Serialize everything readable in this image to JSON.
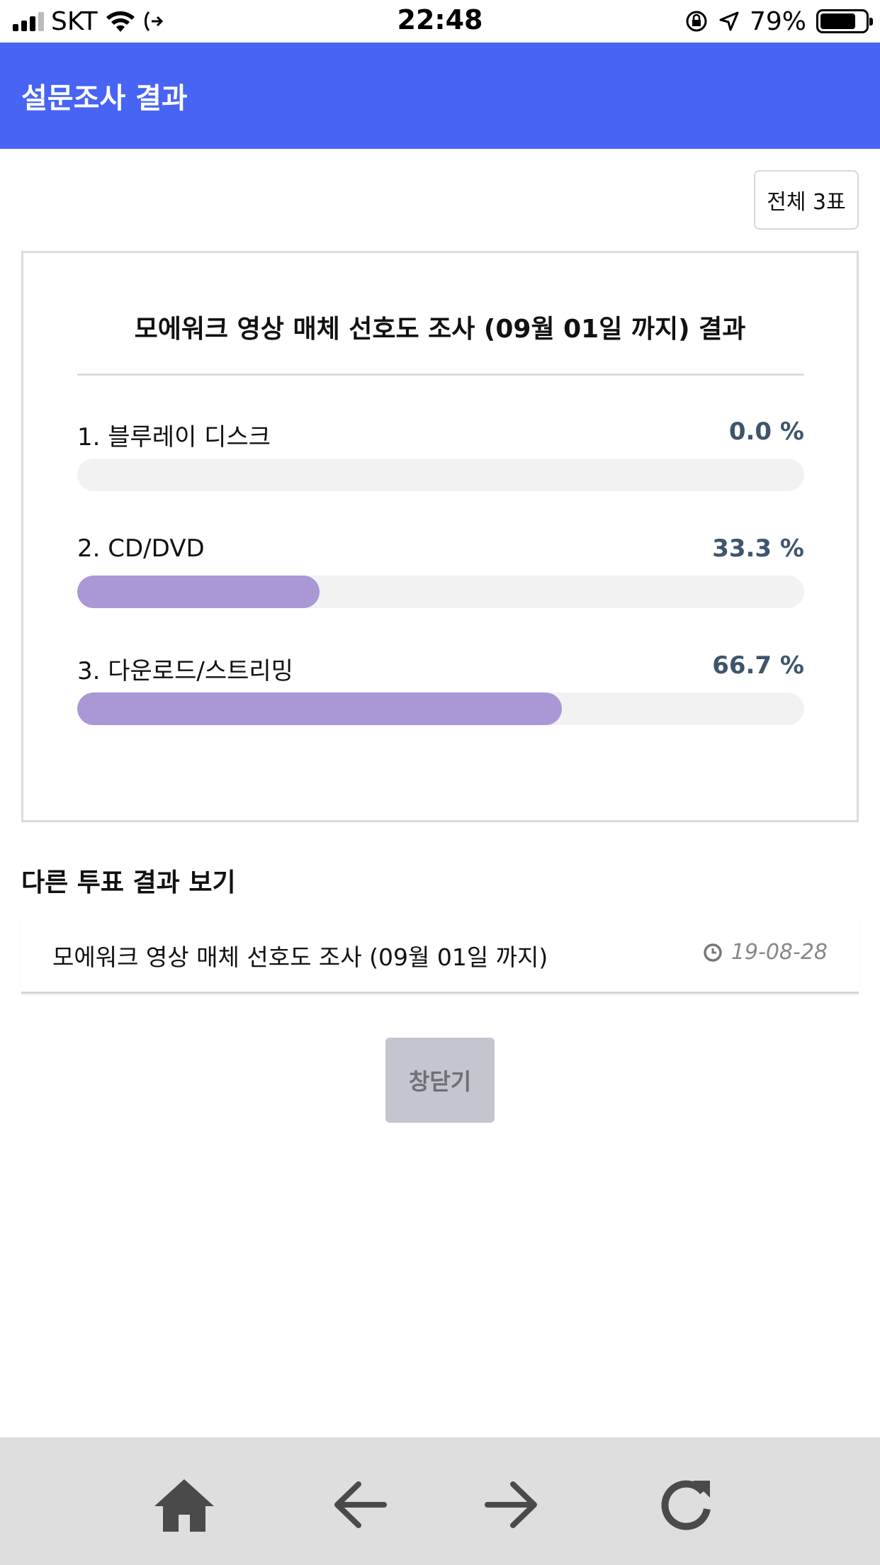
{
  "status_bar": {
    "carrier": "SKT",
    "time": "22:48",
    "battery": "79%",
    "battery_level": 0.79,
    "icons": [
      "signal-icon",
      "wifi-icon",
      "call-forward-icon",
      "rotation-lock-icon",
      "location-icon",
      "battery-icon"
    ]
  },
  "app_bar": {
    "title": "설문조사 결과"
  },
  "total_votes": "전체 3표",
  "result": {
    "title": "모에워크 영상 매체 선호도 조사 (09월 01일 까지) 결과",
    "options": [
      {
        "label": "1. 블루레이 디스크",
        "percent_text": "0.0 %",
        "percent": 0.0
      },
      {
        "label": "2. CD/DVD",
        "percent_text": "33.3 %",
        "percent": 33.3
      },
      {
        "label": "3. 다운로드/스트리밍",
        "percent_text": "66.7 %",
        "percent": 66.7
      }
    ],
    "bar_color": "#aa98d6"
  },
  "other_votes": {
    "title": "다른 투표 결과 보기",
    "items": [
      {
        "title": "모에워크 영상 매체 선호도 조사 (09월 01일 까지)",
        "date": "19-08-28",
        "icon": "clock-icon"
      }
    ]
  },
  "close_button": "창닫기",
  "bottom_nav": {
    "icons": [
      "home-icon",
      "arrow-left-icon",
      "arrow-right-icon",
      "refresh-icon"
    ]
  },
  "colors": {
    "accent": "#4864f5",
    "percent_text": "#3f556e"
  }
}
